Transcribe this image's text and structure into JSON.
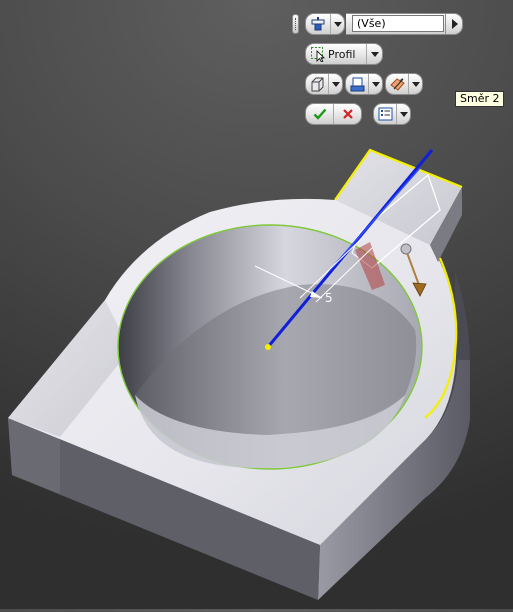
{
  "mini_toolbar": {
    "filter_value": "(Vše)",
    "profile_label": "Profil"
  },
  "tooltip": {
    "text": "Směr 2"
  },
  "dimension": {
    "value": "5"
  },
  "icons": {
    "selection_filter": "selection-filter-icon",
    "profile": "profile-select-icon",
    "solid": "solid-box-icon",
    "output": "output-type-icon",
    "direction": "direction-icon",
    "ok": "checkmark-icon",
    "cancel": "cancel-x-icon",
    "options": "options-list-icon"
  },
  "colors": {
    "ok": "#1a9a1a",
    "cancel": "#d42020",
    "axis": "#1020d8",
    "edge_highlight": "#f5f000",
    "profile_outline": "#7fc83a",
    "part_face": "#e9e9ee"
  }
}
